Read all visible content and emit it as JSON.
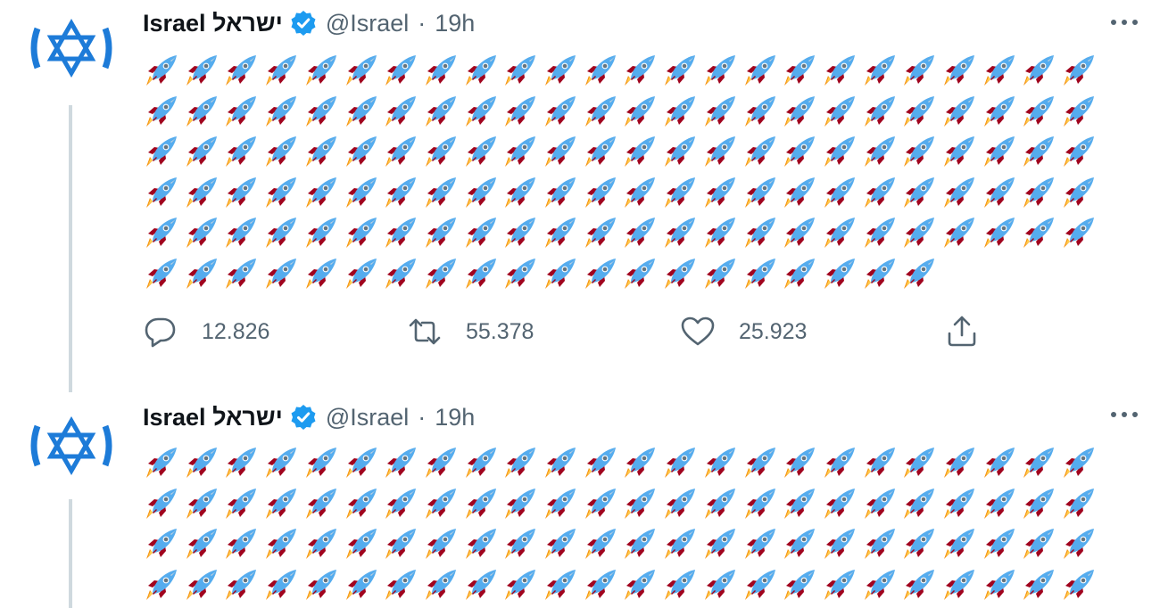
{
  "tweets": [
    {
      "display_name": "Israel ישראל",
      "handle": "@Israel",
      "separator": "·",
      "time": "19h",
      "avatar_icon": "star-of-david-icon",
      "rocket_rows": [
        24,
        24,
        24,
        24,
        24,
        20
      ],
      "actions": {
        "reply_count": "12.826",
        "retweet_count": "55.378",
        "like_count": "25.923"
      }
    },
    {
      "display_name": "Israel ישראל",
      "handle": "@Israel",
      "separator": "·",
      "time": "19h",
      "avatar_icon": "star-of-david-icon",
      "rocket_rows": [
        24,
        24,
        24,
        24
      ]
    }
  ],
  "colors": {
    "text": "#0f1419",
    "secondary": "#536471",
    "verified_blue": "#1d9bf0",
    "flag_blue": "#1d7bd8",
    "thread_line": "#cfd9de"
  },
  "icons": {
    "reply": "reply-icon",
    "retweet": "retweet-icon",
    "like": "heart-icon",
    "share": "share-icon",
    "more": "more-icon",
    "verified": "verified-badge-icon",
    "emoji": "rocket-emoji"
  }
}
